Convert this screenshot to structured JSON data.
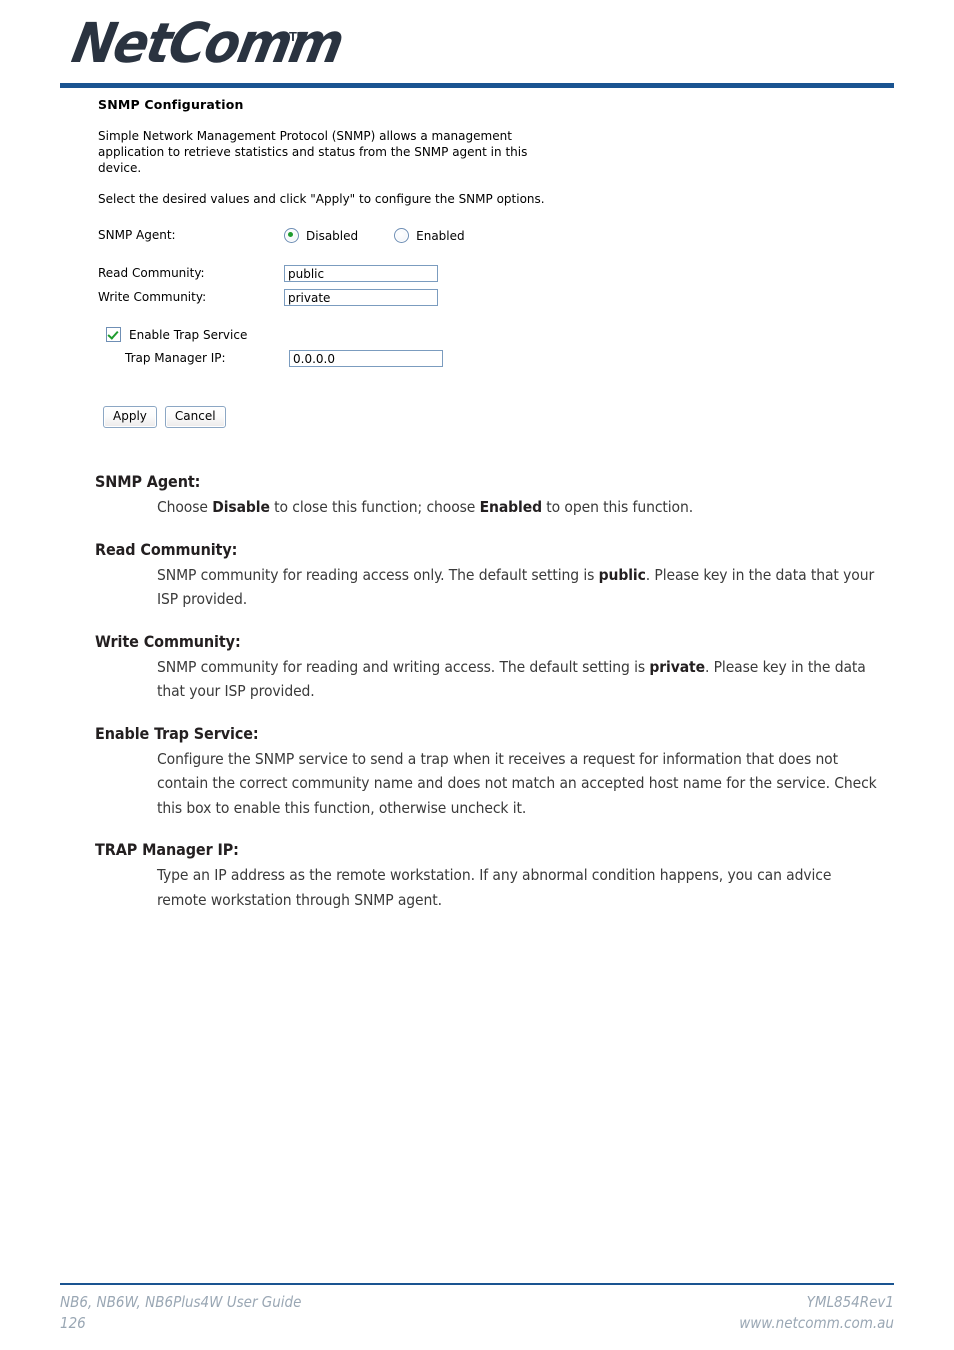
{
  "header": {
    "brand": "NetComm",
    "trademark": "TM",
    "rule_color": "#1a5491"
  },
  "router_ui": {
    "title": "SNMP Configuration",
    "intro_paragraph": "Simple Network Management Protocol (SNMP) allows a management application to retrieve statistics and status from the SNMP agent in this device.",
    "instruction_paragraph": "Select the desired values and click \"Apply\" to configure the SNMP options.",
    "snmp_agent": {
      "label": "SNMP Agent:",
      "options": [
        {
          "label": "Disabled",
          "selected": true
        },
        {
          "label": "Enabled",
          "selected": false
        }
      ],
      "selected_value": "Disabled"
    },
    "read_community": {
      "label": "Read Community:",
      "value": "public"
    },
    "write_community": {
      "label": "Write Community:",
      "value": "private"
    },
    "trap_service": {
      "label": "Enable Trap Service",
      "checked": true
    },
    "trap_manager_ip": {
      "label": "Trap Manager IP:",
      "value": "0.0.0.0"
    },
    "buttons": {
      "apply": "Apply",
      "cancel": "Cancel"
    },
    "accent_colors": {
      "control_border": "#7b9cbf",
      "radio_dot": "#1e9c2e",
      "checkmark": "#1e9c2e"
    }
  },
  "definitions": [
    {
      "term": "SNMP Agent:",
      "desc_parts": [
        {
          "text": "Choose ",
          "bold": false
        },
        {
          "text": "Disable",
          "bold": true
        },
        {
          "text": " to close this function; choose ",
          "bold": false
        },
        {
          "text": "Enabled",
          "bold": true
        },
        {
          "text": " to open this function.",
          "bold": false
        }
      ]
    },
    {
      "term": "Read Community:",
      "desc_parts": [
        {
          "text": "SNMP community for reading access only. The default setting is ",
          "bold": false
        },
        {
          "text": "public",
          "bold": true
        },
        {
          "text": ". Please key in the data that your ISP provided.",
          "bold": false
        }
      ]
    },
    {
      "term": "Write Community:",
      "desc_parts": [
        {
          "text": "SNMP community for reading and writing access. The default setting is ",
          "bold": false
        },
        {
          "text": "private",
          "bold": true
        },
        {
          "text": ". Please key in the data that your ISP provided.",
          "bold": false
        }
      ]
    },
    {
      "term": "Enable Trap Service:",
      "desc_parts": [
        {
          "text": "Configure the SNMP service to send a trap when it receives a request for information that does not contain the correct community name and does not match an accepted host name for the service. Check this box to enable this function, otherwise uncheck it.",
          "bold": false
        }
      ]
    },
    {
      "term": "TRAP Manager IP:",
      "desc_parts": [
        {
          "text": "Type an IP address as the remote workstation. If any abnormal condition happens, you can advice remote workstation through SNMP agent.",
          "bold": false
        }
      ]
    }
  ],
  "footer": {
    "guide_title": "NB6, NB6W, NB6Plus4W User Guide",
    "page_number": "126",
    "revision": "YML854Rev1",
    "website": "www.netcomm.com.au"
  }
}
